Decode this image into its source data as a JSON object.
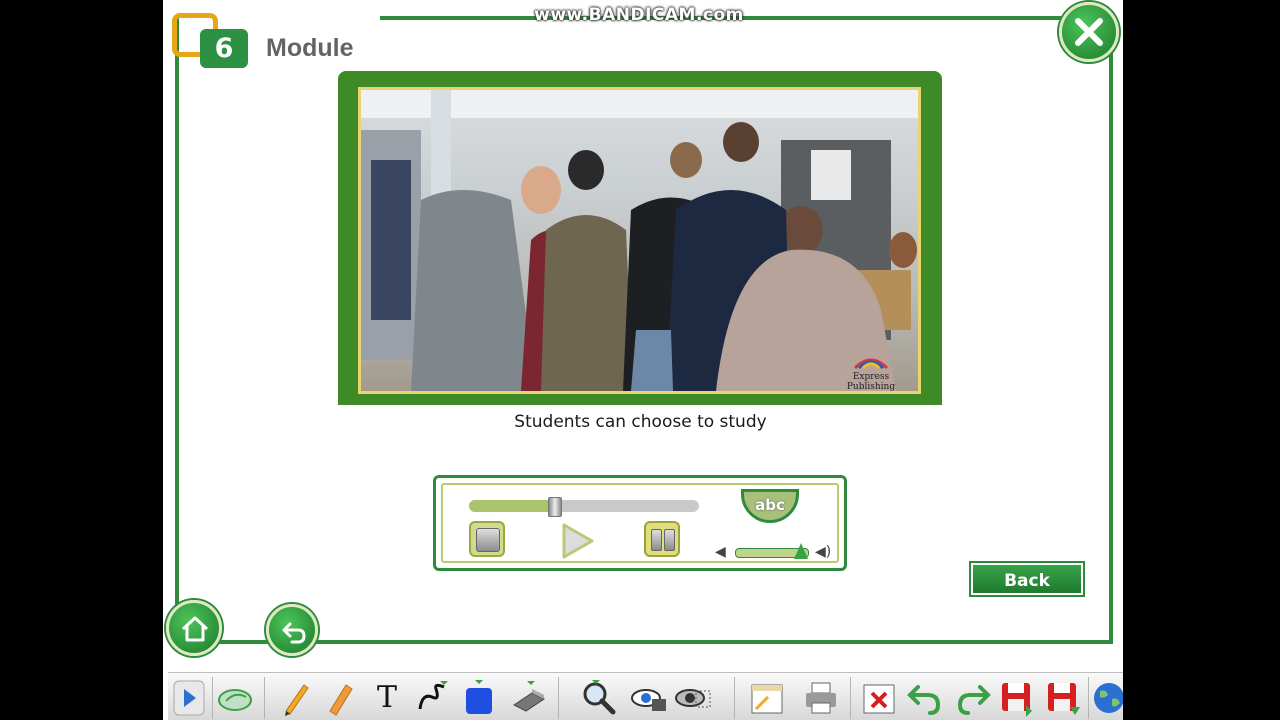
{
  "watermark": "www.BANDICAM.com",
  "header": {
    "module_number": "6",
    "module_title": "Module"
  },
  "video": {
    "caption": "Students can choose to study",
    "publisher_logo_text": "Express Publishing"
  },
  "player": {
    "progress": 0.37,
    "volume": 0.9,
    "subtitles_label": "abc"
  },
  "buttons": {
    "back_label": "Back"
  },
  "colors": {
    "primary_green": "#2e8b3d",
    "accent_orange": "#e6a615",
    "video_frame": "#3e8a26"
  },
  "toolbar": {
    "icons": [
      "expand-arrow-icon",
      "mouse-icon",
      "pencil-icon",
      "marker-icon",
      "text-icon",
      "freehand-line-icon",
      "shape-icon",
      "eraser-icon",
      "zoom-icon",
      "reveal-icon",
      "hide-icon",
      "whiteboard-icon",
      "print-icon",
      "clear-icon",
      "undo-icon",
      "redo-icon",
      "save-icon",
      "save-as-icon",
      "globe-icon"
    ],
    "text_tool_label": "T"
  }
}
